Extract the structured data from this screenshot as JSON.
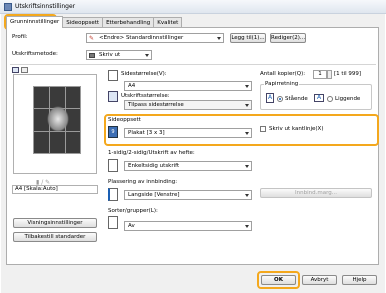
{
  "window": {
    "title": "Utskriftsinnstillinger"
  },
  "tabs": [
    {
      "label": "Grunninnstillinger"
    },
    {
      "label": "Sideoppsett"
    },
    {
      "label": "Etterbehandling"
    },
    {
      "label": "Kvalitet"
    }
  ],
  "profile": {
    "label": "Profil:",
    "value": "<Endre> Standardinnstillinger",
    "add_button": "Legg til(1)...",
    "edit_button": "Rediger(2)..."
  },
  "output_method": {
    "label": "Utskriftsmetode:",
    "value": "Skriv ut"
  },
  "page_size": {
    "label": "Sidestørrelse(V):",
    "value": "A4"
  },
  "output_size": {
    "label": "Utskriftsstørrelse:",
    "value": "Tilpass sidestørrelse"
  },
  "copies": {
    "label": "Antall kopier(Q):",
    "value": "1",
    "range": "[1 til 999]"
  },
  "orientation": {
    "group_label": "Papirretning",
    "portrait": "Stående",
    "landscape": "Liggende",
    "selected": "portrait"
  },
  "page_layout": {
    "group_label": "Sideoppsett",
    "value": "Plakat [3 x 3]",
    "border_checkbox": "Skriv ut kantlinje(X)",
    "border_checked": false
  },
  "duplex": {
    "label": "1-sidig/2-sidig/Utskrift av hefte:",
    "value": "Enkeltsidig utskrift"
  },
  "binding": {
    "label": "Plassering av innbinding:",
    "value": "Langside [Venstre]",
    "button": "Innbind.marg..."
  },
  "collate": {
    "label": "Sorter/grupper(L):",
    "value": "Av"
  },
  "preview": {
    "caption": "A4 [Skala:Auto]"
  },
  "left_buttons": {
    "view_settings": "Visningsinnstillinger",
    "restore_defaults": "Tilbakestill standarder"
  },
  "footer": {
    "ok": "OK",
    "cancel": "Avbryt",
    "help": "Hjelp"
  },
  "colors": {
    "highlight": "#f4a81d",
    "accent": "#1a5fb4"
  }
}
